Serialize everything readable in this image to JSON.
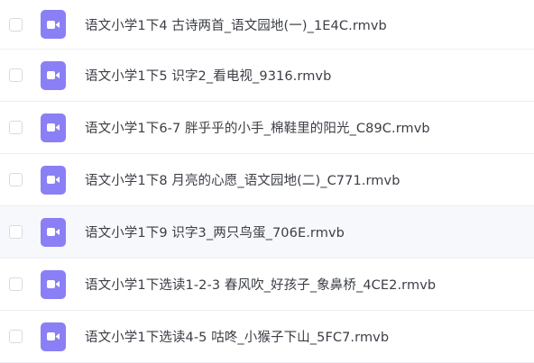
{
  "file_list": {
    "icon_type": "video-file-icon",
    "icon_color": "#8b7ff5",
    "hover_row_index": 4,
    "items": [
      {
        "name": "语文小学1下4 古诗两首_语文园地(一)_1E4C.rmvb",
        "checked": false
      },
      {
        "name": "语文小学1下5 识字2_看电视_9316.rmvb",
        "checked": false
      },
      {
        "name": "语文小学1下6-7 胖乎乎的小手_棉鞋里的阳光_C89C.rmvb",
        "checked": false
      },
      {
        "name": "语文小学1下8 月亮的心愿_语文园地(二)_C771.rmvb",
        "checked": false
      },
      {
        "name": "语文小学1下9 识字3_两只鸟蛋_706E.rmvb",
        "checked": false
      },
      {
        "name": "语文小学1下选读1-2-3 春风吹_好孩子_象鼻桥_4CE2.rmvb",
        "checked": false
      },
      {
        "name": "语文小学1下选读4-5 咕咚_小猴子下山_5FC7.rmvb",
        "checked": false
      }
    ]
  }
}
